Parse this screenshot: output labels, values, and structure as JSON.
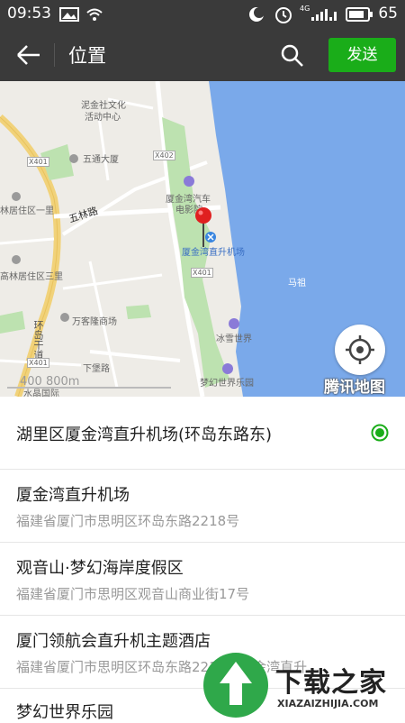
{
  "status_bar": {
    "time": "09:53",
    "battery": "65",
    "network": "4G"
  },
  "toolbar": {
    "title": "位置",
    "send_label": "发送"
  },
  "map": {
    "labels": {
      "poi1": "泥金社文化",
      "poi1b": "活动中心",
      "poi2": "五通大厦",
      "road1": "五林路",
      "poi3": "林居住区一里",
      "poi4": "高林居住区三里",
      "road2": "环岛干道",
      "poi5": "万客隆商场",
      "road3": "下堡路",
      "poi6": "水晶国际",
      "poi7": "厦金湾汽车",
      "poi7b": "电影院",
      "poi8": "厦金湾直升机场",
      "poi9": "冰雪世界",
      "poi10": "梦幻世界乐园",
      "poi11": "马祖",
      "road4": "X401",
      "road5": "X402",
      "road6": "X401",
      "road7": "X401"
    },
    "scale": "400   800m",
    "brand": "腾讯地图"
  },
  "locations": [
    {
      "title": "湖里区厦金湾直升机场(环岛东路东)",
      "subtitle": "",
      "selected": true
    },
    {
      "title": "厦金湾直升机场",
      "subtitle": "福建省厦门市思明区环岛东路2218号"
    },
    {
      "title": "观音山·梦幻海岸度假区",
      "subtitle": "福建省厦门市思明区观音山商业街17号"
    },
    {
      "title": "厦门领航会直升机主题酒店",
      "subtitle": "福建省厦门市思明区环岛东路2216号厦金湾直升..."
    },
    {
      "title": "梦幻世界乐园",
      "subtitle": ""
    }
  ],
  "watermark": {
    "text": "下载之家",
    "sub": "XIAZAIZHIJIA.COM"
  },
  "colors": {
    "accent": "#1aad19",
    "toolbar": "#3a3a3a",
    "sea": "#7aa9ea"
  }
}
